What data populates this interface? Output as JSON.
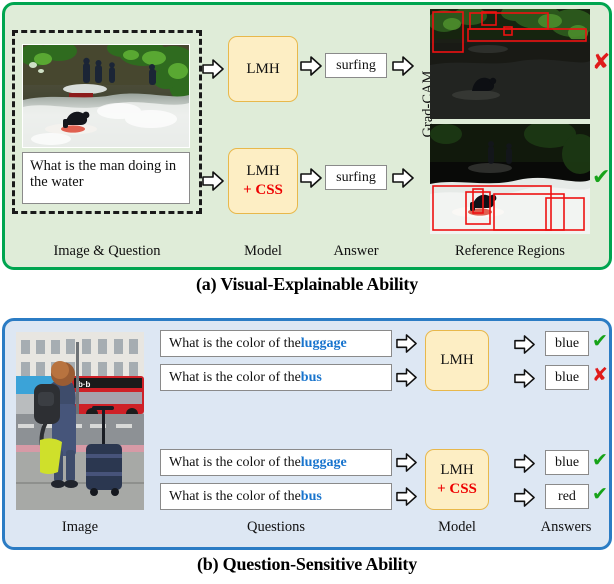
{
  "figure": {
    "panel_a": {
      "caption": "(a) Visual-Explainable Ability",
      "border_color": "#00a550",
      "bg_color": "#dfecd8",
      "column_labels": [
        "Image & Question",
        "Model",
        "Answer",
        "Reference Regions"
      ],
      "question": "What is the man doing in the water",
      "image_alt": "surfer-on-river-wave",
      "rows": [
        {
          "model": "LMH",
          "model_extra": "",
          "answer": "surfing",
          "verdict": "cross",
          "verdict_symbol": "✘",
          "verdict_color": "#e01b1b",
          "reference_alt": "grad-cam-regions-trees-background"
        },
        {
          "model": "LMH",
          "model_extra": "+ CSS",
          "answer": "surfing",
          "verdict": "tick",
          "verdict_symbol": "✔",
          "verdict_color": "#17a319",
          "reference_alt": "grad-cam-regions-surfer-on-board"
        }
      ],
      "pipeline_label": "Grad-CAM"
    },
    "panel_b": {
      "caption": "(b) Question-Sensitive Ability",
      "border_color": "#2b7cc4",
      "bg_color": "#dde7f3",
      "column_labels": [
        "Image",
        "Questions",
        "Model",
        "Answers"
      ],
      "image_alt": "woman-with-backpack-and-luggage-at-bus-stop",
      "groups": [
        {
          "model": "LMH",
          "model_extra": "",
          "rows": [
            {
              "question_prefix": "What is the color of the ",
              "question_keyword": "luggage",
              "answer": "blue",
              "verdict": "tick",
              "verdict_symbol": "✔",
              "verdict_color": "#17a319"
            },
            {
              "question_prefix": "What is the color of the ",
              "question_keyword": "bus",
              "answer": "blue",
              "verdict": "cross",
              "verdict_symbol": "✘",
              "verdict_color": "#e01b1b"
            }
          ]
        },
        {
          "model": "LMH",
          "model_extra": "+ CSS",
          "rows": [
            {
              "question_prefix": "What is the color of the ",
              "question_keyword": "luggage",
              "answer": "blue",
              "verdict": "tick",
              "verdict_symbol": "✔",
              "verdict_color": "#17a319"
            },
            {
              "question_prefix": "What is the color of the ",
              "question_keyword": "bus",
              "answer": "red",
              "verdict": "tick",
              "verdict_symbol": "✔",
              "verdict_color": "#17a319"
            }
          ]
        }
      ]
    },
    "colors": {
      "model_box_fill": "#fdeec4",
      "model_box_border": "#e8b84b",
      "css_accent": "#ee0000",
      "keyword_accent": "#1874cd",
      "bbox_red": "#ee1111"
    }
  }
}
